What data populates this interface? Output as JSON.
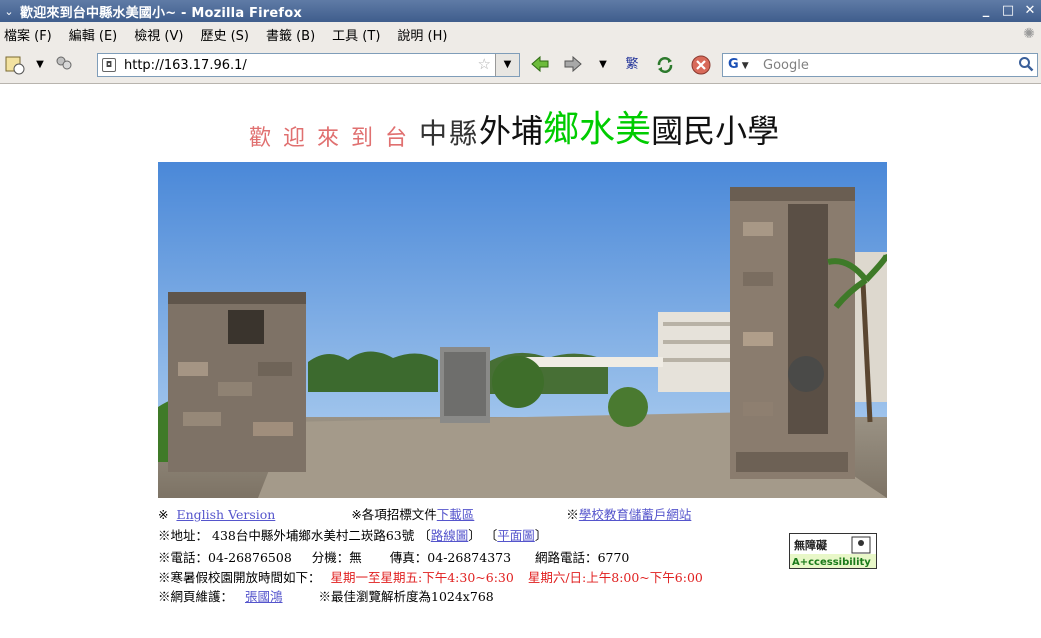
{
  "window": {
    "title": "歡迎來到台中縣水美國小~ - Mozilla Firefox",
    "buttons": {
      "minimize": "_",
      "maximize": "□",
      "close": "✕"
    }
  },
  "menu": {
    "items": [
      "檔案 (F)",
      "編輯 (E)",
      "檢視 (V)",
      "歷史 (S)",
      "書籤 (B)",
      "工具 (T)",
      "說明 (H)"
    ]
  },
  "toolbar": {
    "url": "http://163.17.96.1/",
    "search_placeholder": "Google",
    "engine_label": "G"
  },
  "page": {
    "title_part1": "歡迎來到台",
    "title_part2": "中縣",
    "title_part3": "外埔",
    "title_part4": "鄉水美",
    "title_part5": "國民小學",
    "links_row": {
      "prefix1": "※",
      "english": "English Version",
      "prefix2": "※各項招標文件",
      "download": "下載區",
      "prefix3": "※",
      "portal": "學校教育儲蓄戶網站"
    },
    "address": {
      "label": "※地址：",
      "value": "438台中縣外埔鄉水美村二崁路63號",
      "open1": "〔",
      "route_link": "路線圖",
      "close1": "〕",
      "open2": "〔",
      "plan_link": "平面圖",
      "close2": "〕"
    },
    "phone": {
      "label": "※電話：",
      "value": "04-26876508",
      "ext_label": "分機：",
      "ext_value": "無",
      "fax_label": "傳真：",
      "fax_value": "04-26874373",
      "net_label": "網路電話：",
      "net_value": "6770"
    },
    "hours": {
      "label": "※寒暑假校園開放時間如下：",
      "weekday": "星期一至星期五:下午4:30~6:30",
      "weekend": "星期六/日:上午8:00~下午6:00"
    },
    "maint": {
      "label": "※網頁維護：",
      "name": "張國鴻",
      "resolution": "※最佳瀏覽解析度為1024x768"
    },
    "badge": {
      "top": "無障礙",
      "bottom": "A+ccessibility"
    }
  }
}
